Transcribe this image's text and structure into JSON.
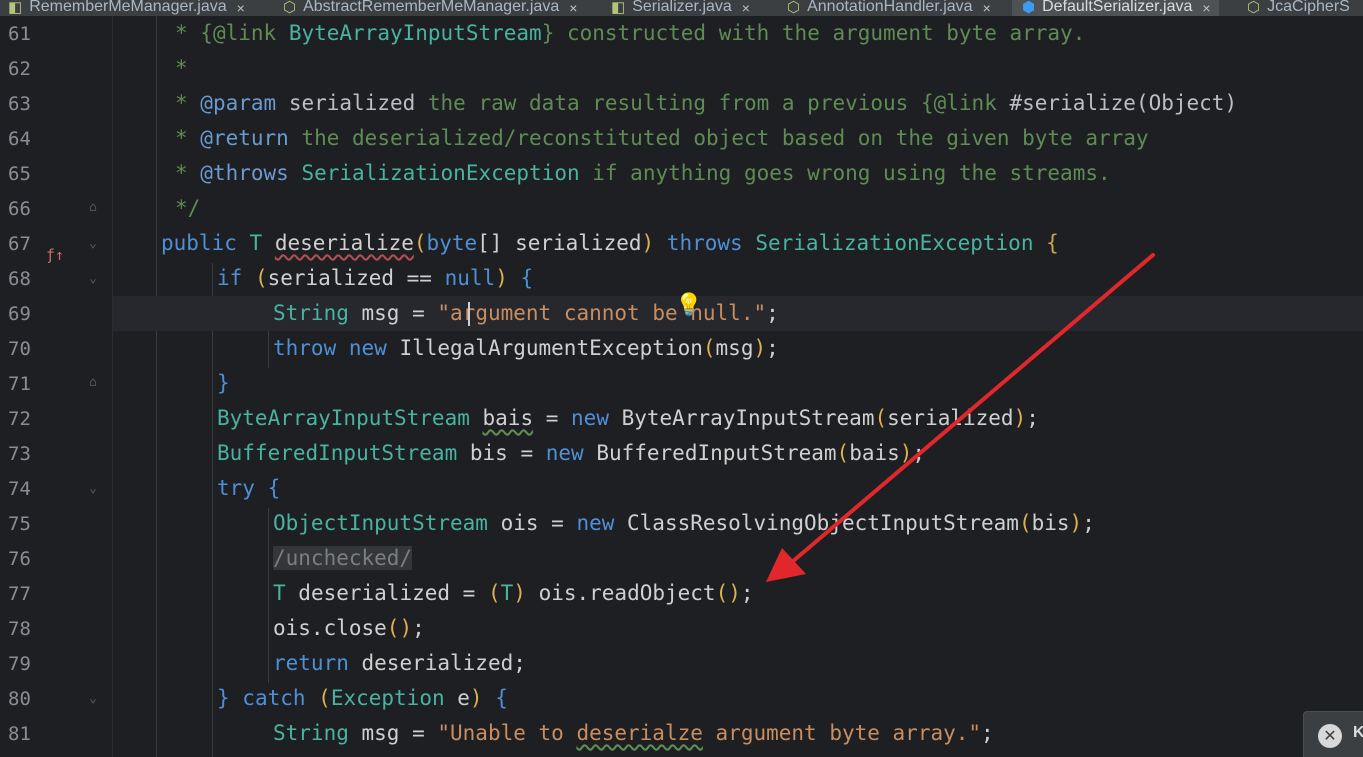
{
  "tabs": [
    {
      "label": "RememberMeManager.java",
      "icon": "interface-icon",
      "active": false
    },
    {
      "label": "AbstractRememberMeManager.java",
      "icon": "class-icon",
      "active": false
    },
    {
      "label": "Serializer.java",
      "icon": "interface-icon",
      "active": false
    },
    {
      "label": "AnnotationHandler.java",
      "icon": "class-icon",
      "active": false
    },
    {
      "label": "DefaultSerializer.java",
      "icon": "class-icon",
      "active": true
    },
    {
      "label": "JcaCipherS",
      "icon": "class-icon",
      "active": false
    }
  ],
  "tab_close_glyph": "×",
  "lines": {
    "l61": {
      "num": "61",
      "a": "* ",
      "b": "{@link ",
      "c": "ByteArrayInputStream",
      "d": "} constructed with the argument byte array."
    },
    "l62": {
      "num": "62",
      "a": "*"
    },
    "l63": {
      "num": "63",
      "a": "* ",
      "b": "@param ",
      "c": "serialized",
      "d": " the raw data resulting from a previous ",
      "e": "{@link ",
      "f": "#serialize",
      "g": "(Object)"
    },
    "l64": {
      "num": "64",
      "a": "* ",
      "b": "@return",
      "d": " the deserialized/reconstituted object based on the given byte array"
    },
    "l65": {
      "num": "65",
      "a": "* ",
      "b": "@throws ",
      "c": "SerializationException",
      "d": " if anything goes wrong using the streams."
    },
    "l66": {
      "num": "66",
      "a": "*/"
    },
    "l67": {
      "num": "67",
      "kw1": "public ",
      "t1": "T ",
      "m": "deserialize",
      "p1": "(",
      "kw2": "byte",
      "br": "[] ",
      "v": "serialized",
      "p2": ") ",
      "kw3": "throws ",
      "t2": "SerializationException ",
      "b": "{"
    },
    "l68": {
      "num": "68",
      "kw": "if ",
      "p1": "(",
      "v": "serialized == ",
      "kw2": "null",
      "p2": ") ",
      "b": "{"
    },
    "l69": {
      "num": "69",
      "t": "String ",
      "v": "msg = ",
      "s1": "\"",
      "s2": "argument cannot be null.\"",
      "end": ";"
    },
    "l70": {
      "num": "70",
      "kw": "throw new ",
      "t": "IllegalArgumentException",
      "p1": "(",
      "v": "msg",
      "p2": ")",
      "end": ";"
    },
    "l71": {
      "num": "71",
      "b": "}"
    },
    "l72": {
      "num": "72",
      "t": "ByteArrayInputStream ",
      "v": "bais",
      "eq": " = ",
      "kw": "new ",
      "t2": "ByteArrayInputStream",
      "p1": "(",
      "v2": "serialized",
      "p2": ")",
      "end": ";"
    },
    "l73": {
      "num": "73",
      "t": "BufferedInputStream ",
      "v": "bis = ",
      "kw": "new ",
      "t2": "BufferedInputStream",
      "p1": "(",
      "v2": "bais",
      "p2": ")",
      "end": ";"
    },
    "l74": {
      "num": "74",
      "kw": "try ",
      "b": "{"
    },
    "l75": {
      "num": "75",
      "t": "ObjectInputStream ",
      "v": "ois = ",
      "kw": "new ",
      "t2": "ClassResolvingObjectInputStream",
      "p1": "(",
      "v2": "bis",
      "p2": ")",
      "end": ";"
    },
    "l76": {
      "num": "76",
      "c": "/unchecked/"
    },
    "l77": {
      "num": "77",
      "t": "T ",
      "v": "deserialized = ",
      "p1": "(",
      "t2": "T",
      "p2": ")",
      "v2": " ois.readObject",
      "p3": "()",
      "end": ";"
    },
    "l78": {
      "num": "78",
      "v": "ois.close",
      "p1": "()",
      "end": ";"
    },
    "l79": {
      "num": "79",
      "kw": "return ",
      "v": "deserialized",
      "end": ";"
    },
    "l80": {
      "num": "80",
      "b1": "} ",
      "kw": "catch ",
      "p1": "(",
      "t": "Exception ",
      "v": "e",
      "p2": ") ",
      "b2": "{"
    },
    "l81": {
      "num": "81",
      "t": "String ",
      "v": "msg = ",
      "s1": "\"Unable to ",
      "s2": "deserialze",
      "s3": " argument byte array.\"",
      "end": ";"
    }
  },
  "popup": {
    "icon": "k-icon",
    "label": "K"
  },
  "icons": {
    "bulb": "lightbulb-icon",
    "override": "override-icon",
    "fold": "fold-icon"
  },
  "colors": {
    "background": "#1e1f22",
    "keyword": "#4f8fd6",
    "type": "#49b3a2",
    "string": "#c98e5f",
    "doc": "#5f8c55",
    "arrow": "#e0282c"
  }
}
